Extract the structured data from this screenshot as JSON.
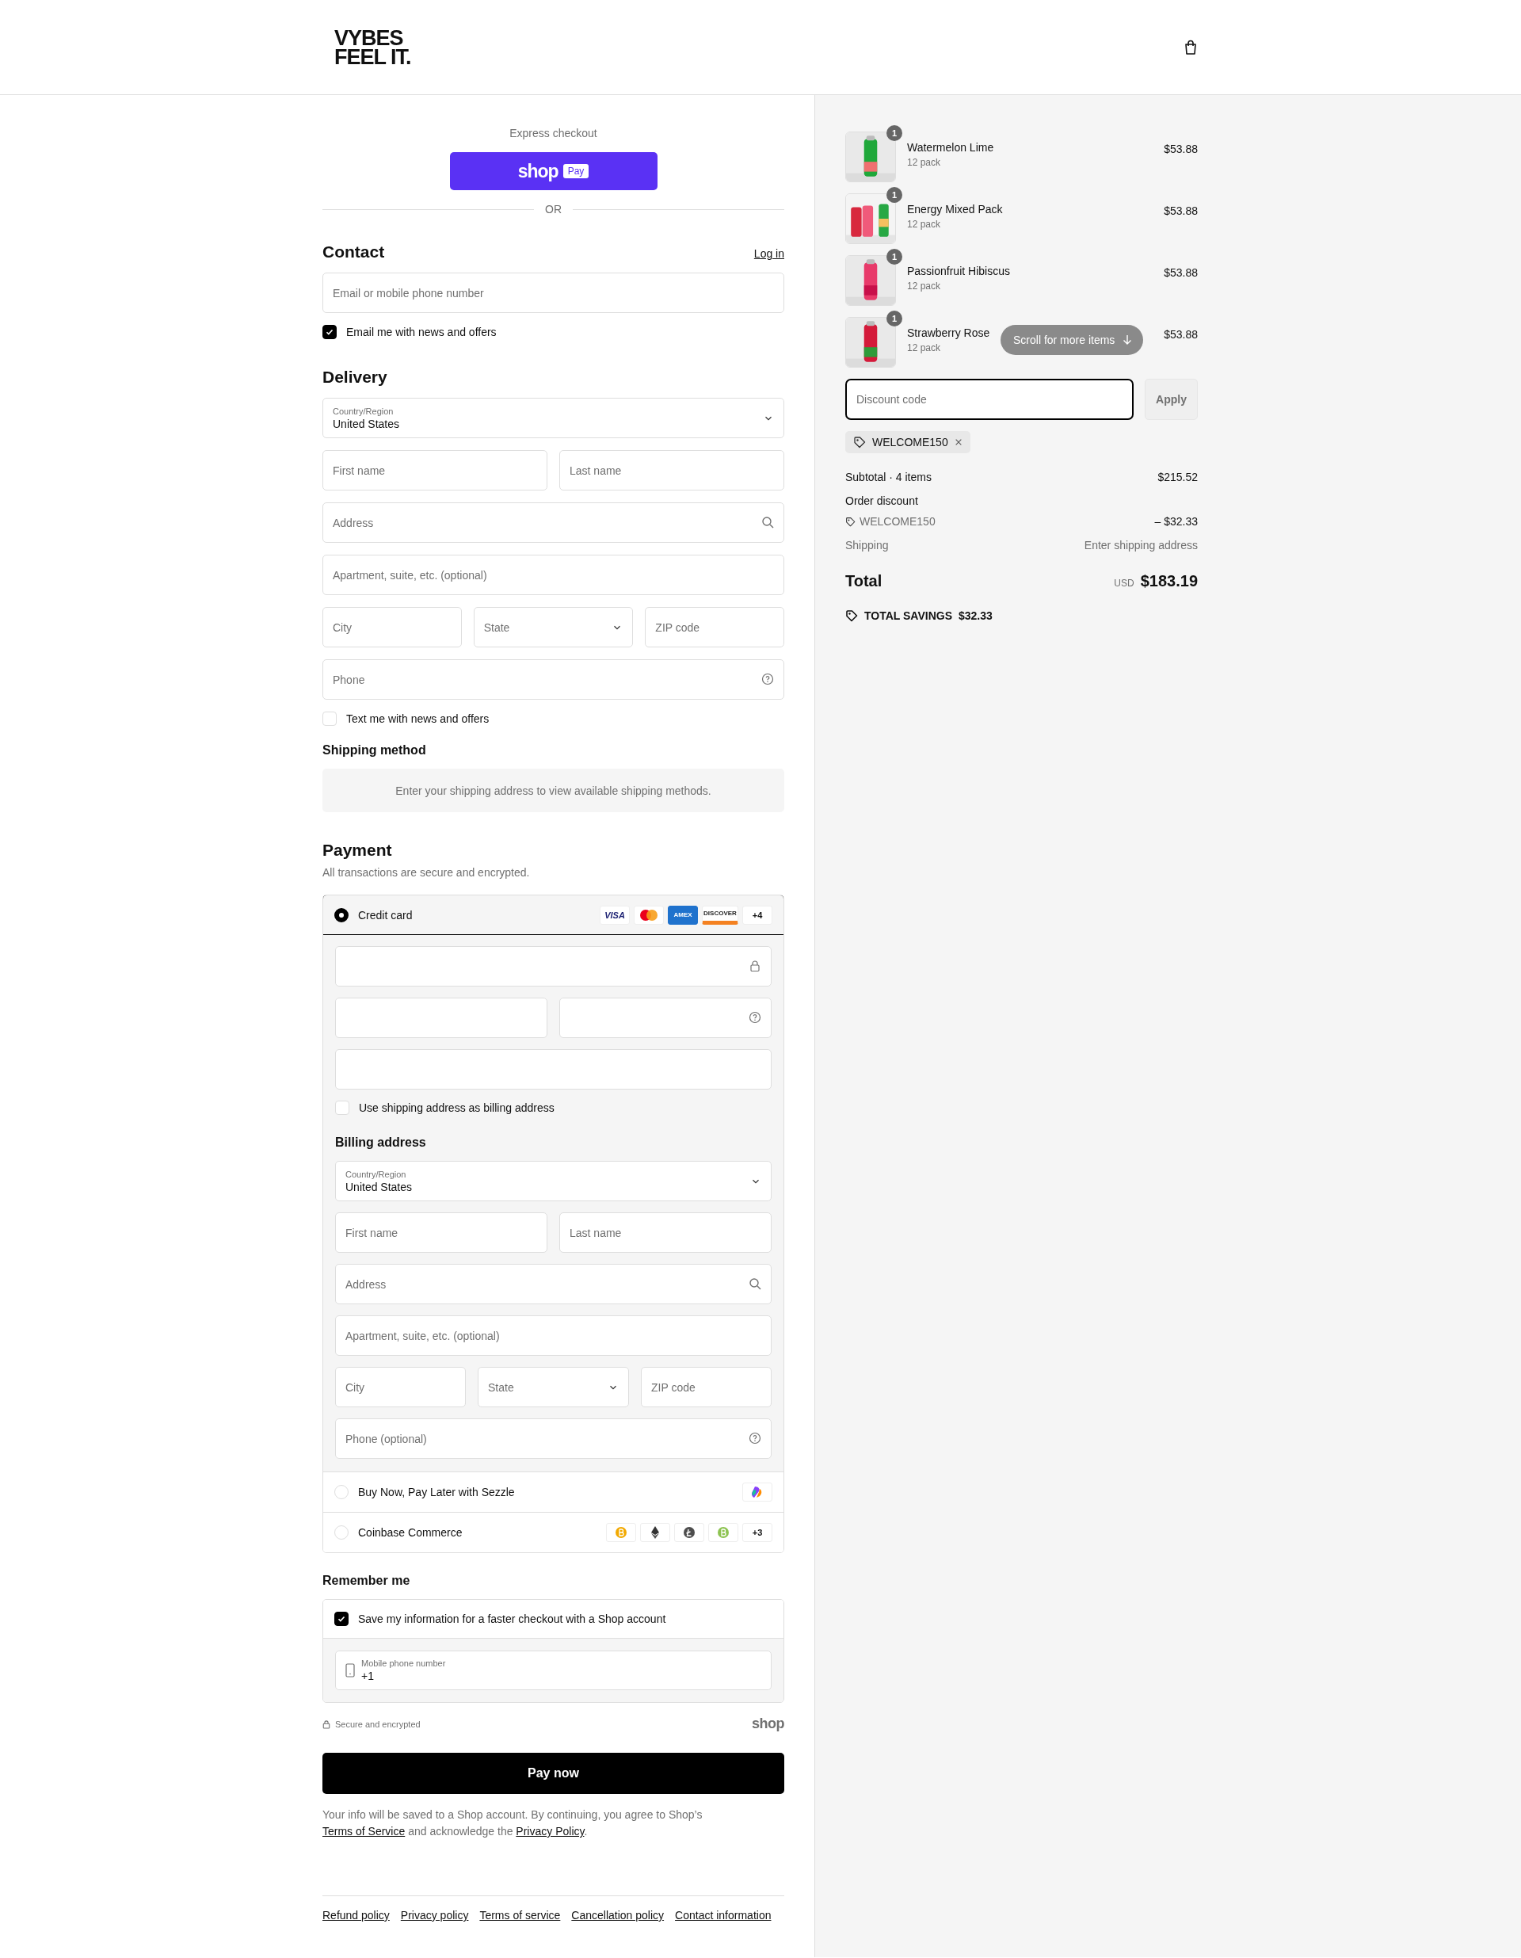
{
  "header": {
    "logo_lines": [
      "VYBES",
      "FEEL IT."
    ]
  },
  "express": {
    "label": "Express checkout",
    "shop_word": "shop",
    "pay_word": "Pay",
    "divider": "OR"
  },
  "contact": {
    "title": "Contact",
    "login": "Log in",
    "email": {
      "placeholder": "Email or mobile phone number"
    },
    "news": {
      "label": "Email me with news and offers",
      "checked": true
    }
  },
  "delivery": {
    "title": "Delivery",
    "rows": [
      [
        {
          "kind": "select",
          "label": "Country/Region",
          "value": "United States"
        }
      ],
      [
        {
          "kind": "input",
          "placeholder": "First name"
        },
        {
          "kind": "input",
          "placeholder": "Last name"
        }
      ],
      [
        {
          "kind": "search_input",
          "placeholder": "Address"
        }
      ],
      [
        {
          "kind": "input",
          "placeholder": "Apartment, suite, etc. (optional)"
        }
      ],
      [
        {
          "kind": "input",
          "placeholder": "City"
        },
        {
          "kind": "select",
          "placeholder": "State"
        },
        {
          "kind": "input",
          "placeholder": "ZIP code"
        }
      ],
      [
        {
          "kind": "help_input",
          "placeholder": "Phone"
        }
      ]
    ],
    "sms": {
      "label": "Text me with news and offers",
      "checked": false
    }
  },
  "shipping_method": {
    "title": "Shipping method",
    "notice": "Enter your shipping address to view available shipping methods."
  },
  "payment": {
    "title": "Payment",
    "subtitle": "All transactions are secure and encrypted.",
    "methods": [
      {
        "kind": "card",
        "label": "Credit card",
        "selected": true,
        "badges": [
          {
            "kind": "visa",
            "text": "VISA"
          },
          {
            "kind": "mastercard"
          },
          {
            "kind": "amex",
            "text": "AMEX"
          },
          {
            "kind": "discover",
            "text": "DISCOVER"
          },
          {
            "kind": "more",
            "text": "+4"
          }
        ],
        "card_rows": [
          [
            {
              "kind": "secure_input"
            }
          ],
          [
            {
              "kind": "input"
            },
            {
              "kind": "help_input"
            }
          ],
          [
            {
              "kind": "input"
            }
          ]
        ],
        "billing_same": {
          "label": "Use shipping address as billing address",
          "checked": false
        },
        "billing_title": "Billing address",
        "billing_rows": [
          [
            {
              "kind": "select",
              "label": "Country/Region",
              "value": "United States"
            }
          ],
          [
            {
              "kind": "input",
              "placeholder": "First name"
            },
            {
              "kind": "input",
              "placeholder": "Last name"
            }
          ],
          [
            {
              "kind": "search_input",
              "placeholder": "Address"
            }
          ],
          [
            {
              "kind": "input",
              "placeholder": "Apartment, suite, etc. (optional)"
            }
          ],
          [
            {
              "kind": "input",
              "placeholder": "City"
            },
            {
              "kind": "select",
              "placeholder": "State"
            },
            {
              "kind": "input",
              "placeholder": "ZIP code"
            }
          ],
          [
            {
              "kind": "help_input",
              "placeholder": "Phone (optional)"
            }
          ]
        ]
      },
      {
        "kind": "sezzle",
        "label": "Buy Now, Pay Later with Sezzle",
        "selected": false,
        "badges": [
          {
            "kind": "sezzle"
          }
        ]
      },
      {
        "kind": "coinbase",
        "label": "Coinbase Commerce",
        "selected": false,
        "badges": [
          {
            "kind": "bitcoin"
          },
          {
            "kind": "ethereum"
          },
          {
            "kind": "litecoin"
          },
          {
            "kind": "bitcoincash"
          },
          {
            "kind": "more",
            "text": "+3"
          }
        ]
      }
    ]
  },
  "remember": {
    "title": "Remember me",
    "save": {
      "label": "Save my information for a faster checkout with a Shop account",
      "checked": true
    },
    "phone": {
      "label": "Mobile phone number",
      "value": "+1"
    }
  },
  "secure": {
    "label": "Secure and encrypted",
    "shop_mark": "shop"
  },
  "pay_button": "Pay now",
  "legal": [
    {
      "kind": "text",
      "text": "Your info will be saved to a Shop account. By continuing, you agree to Shop’s "
    },
    {
      "kind": "link",
      "text": "Terms of Service"
    },
    {
      "kind": "text",
      "text": " and acknowledge the "
    },
    {
      "kind": "link",
      "text": "Privacy Policy"
    },
    {
      "kind": "text",
      "text": "."
    }
  ],
  "footer_links": [
    "Refund policy",
    "Privacy policy",
    "Terms of service",
    "Cancellation policy",
    "Contact information"
  ],
  "summary": {
    "items": [
      {
        "name": "Watermelon Lime",
        "variant": "12 pack",
        "price": "$53.88",
        "quantity": "1"
      },
      {
        "name": "Energy Mixed Pack",
        "variant": "12 pack",
        "price": "$53.88",
        "quantity": "1"
      },
      {
        "name": "Passionfruit Hibiscus",
        "variant": "12 pack",
        "price": "$53.88",
        "quantity": "1"
      },
      {
        "name": "Strawberry Rose",
        "variant": "12 pack",
        "price": "$53.88",
        "quantity": "1"
      }
    ],
    "scroll_hint": "Scroll for more items",
    "discount": {
      "placeholder": "Discount code",
      "focused": true,
      "button": "Apply",
      "disabled": true
    },
    "applied_code": "WELCOME150",
    "lines": [
      {
        "kind": "plain",
        "label": "Subtotal · 4 items",
        "value": "$215.52"
      },
      {
        "kind": "heading",
        "label": "Order discount"
      },
      {
        "kind": "code",
        "label": "WELCOME150",
        "value": "– $32.33"
      },
      {
        "kind": "muted",
        "label": "Shipping",
        "value": "Enter shipping address"
      }
    ],
    "total": {
      "label": "Total",
      "currency": "USD",
      "value": "$183.19"
    },
    "savings": {
      "label": "TOTAL SAVINGS",
      "value": "$32.33"
    }
  }
}
